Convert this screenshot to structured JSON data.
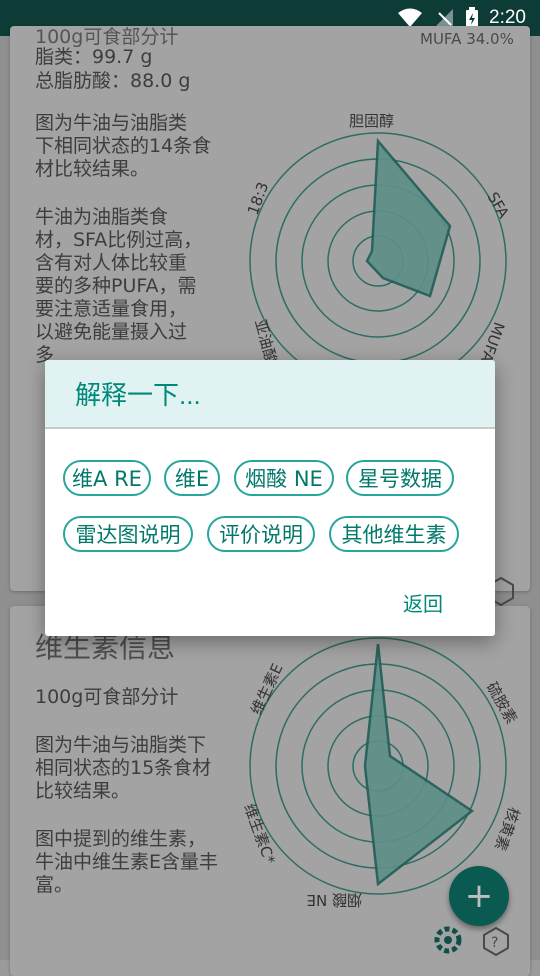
{
  "status_bar": {
    "time": "2:20"
  },
  "card1": {
    "heading_partial": "100g可食部分计",
    "lines": [
      "脂类：99.7 g",
      "总脂肪酸：88.0 g"
    ],
    "para1": "图为牛油与油脂类\n下相同状态的14条食\n材比较结果。",
    "para2": "牛油为油脂类食\n材，SFA比例过高，\n含有对人体比较重\n要的多种PUFA，需\n要注意适量食用，\n以避免能量摄入过\n多",
    "radar_labels": {
      "top": "胆固醇",
      "right_top": "SFA",
      "right_bottom": "MUFA",
      "left_top": "18:3",
      "left_bottom": "亚油酸"
    },
    "mufa_text": "MUFA 34.0%"
  },
  "card2": {
    "title": "维生素信息",
    "subtitle": "100g可食部分计",
    "para1": "图为牛油与油脂类下\n相同状态的15条食材\n比较结果。",
    "para2": "图中提到的维生素，\n牛油中维生素E含量丰\n富。",
    "radar_labels": {
      "left_top": "维生素E",
      "right_top": "硫胺素",
      "right_bottom": "核黄素",
      "bottom": "烟酸 NE",
      "left_bottom": "维生素C*"
    }
  },
  "dialog": {
    "title": "解释一下...",
    "chips": [
      "维A RE",
      "维E",
      "烟酸 NE",
      "星号数据",
      "雷达图说明",
      "评价说明",
      "其他维生素"
    ],
    "back_label": "返回"
  },
  "fab": {
    "icon": "plus-icon"
  },
  "icons": [
    "wifi-icon",
    "signal-icon",
    "battery-icon",
    "settings-icon",
    "help-icon"
  ]
}
